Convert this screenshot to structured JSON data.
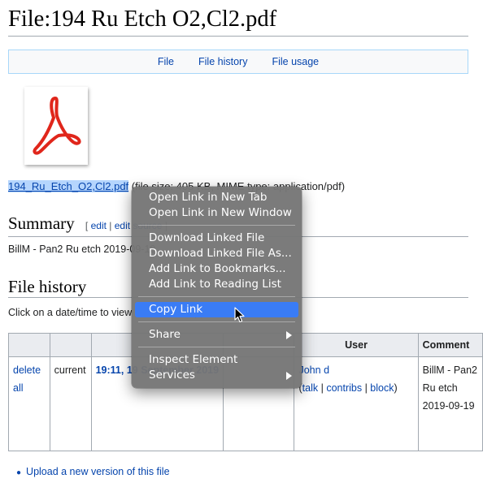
{
  "page": {
    "title": "File:194 Ru Etch O2,Cl2.pdf"
  },
  "file_tabs": [
    "File",
    "File history",
    "File usage"
  ],
  "file": {
    "link": "194_Ru_Etch_O2,Cl2.pdf",
    "info": " (file size: 405 KB, MIME type: application/pdf)",
    "icon": "pdf-icon",
    "icon_color": "#e0261b"
  },
  "summary": {
    "heading": "Summary",
    "edit": "edit",
    "edit_source": "edit source",
    "text": "BillM - Pan2 Ru etch 2019-09-19"
  },
  "history": {
    "heading": "File history",
    "intro": "Click on a date/time to view the file as it appeared at that time.",
    "columns": [
      "",
      "",
      "",
      "",
      "User",
      "Comment"
    ],
    "row": {
      "delete": "delete all",
      "status": "current",
      "datetime": "19:11, 19 September 2019",
      "user": "John d",
      "user_tools_open": "(",
      "talk": "talk",
      "contribs": "contribs",
      "block": "block",
      "user_tools_close": ")",
      "comment": "BillM - Pan2 Ru etch 2019-09-19"
    }
  },
  "upload": "Upload a new version of this file",
  "context_menu": {
    "groups": [
      [
        "Open Link in New Tab",
        "Open Link in New Window"
      ],
      [
        "Download Linked File",
        "Download Linked File As...",
        "Add Link to Bookmarks...",
        "Add Link to Reading List"
      ],
      [
        "Copy Link"
      ],
      [
        "Share"
      ],
      [
        "Inspect Element",
        "Services"
      ]
    ],
    "highlighted": "Copy Link",
    "highlight_color": "#3a7cf5",
    "submenus": [
      "Share",
      "Services"
    ]
  }
}
